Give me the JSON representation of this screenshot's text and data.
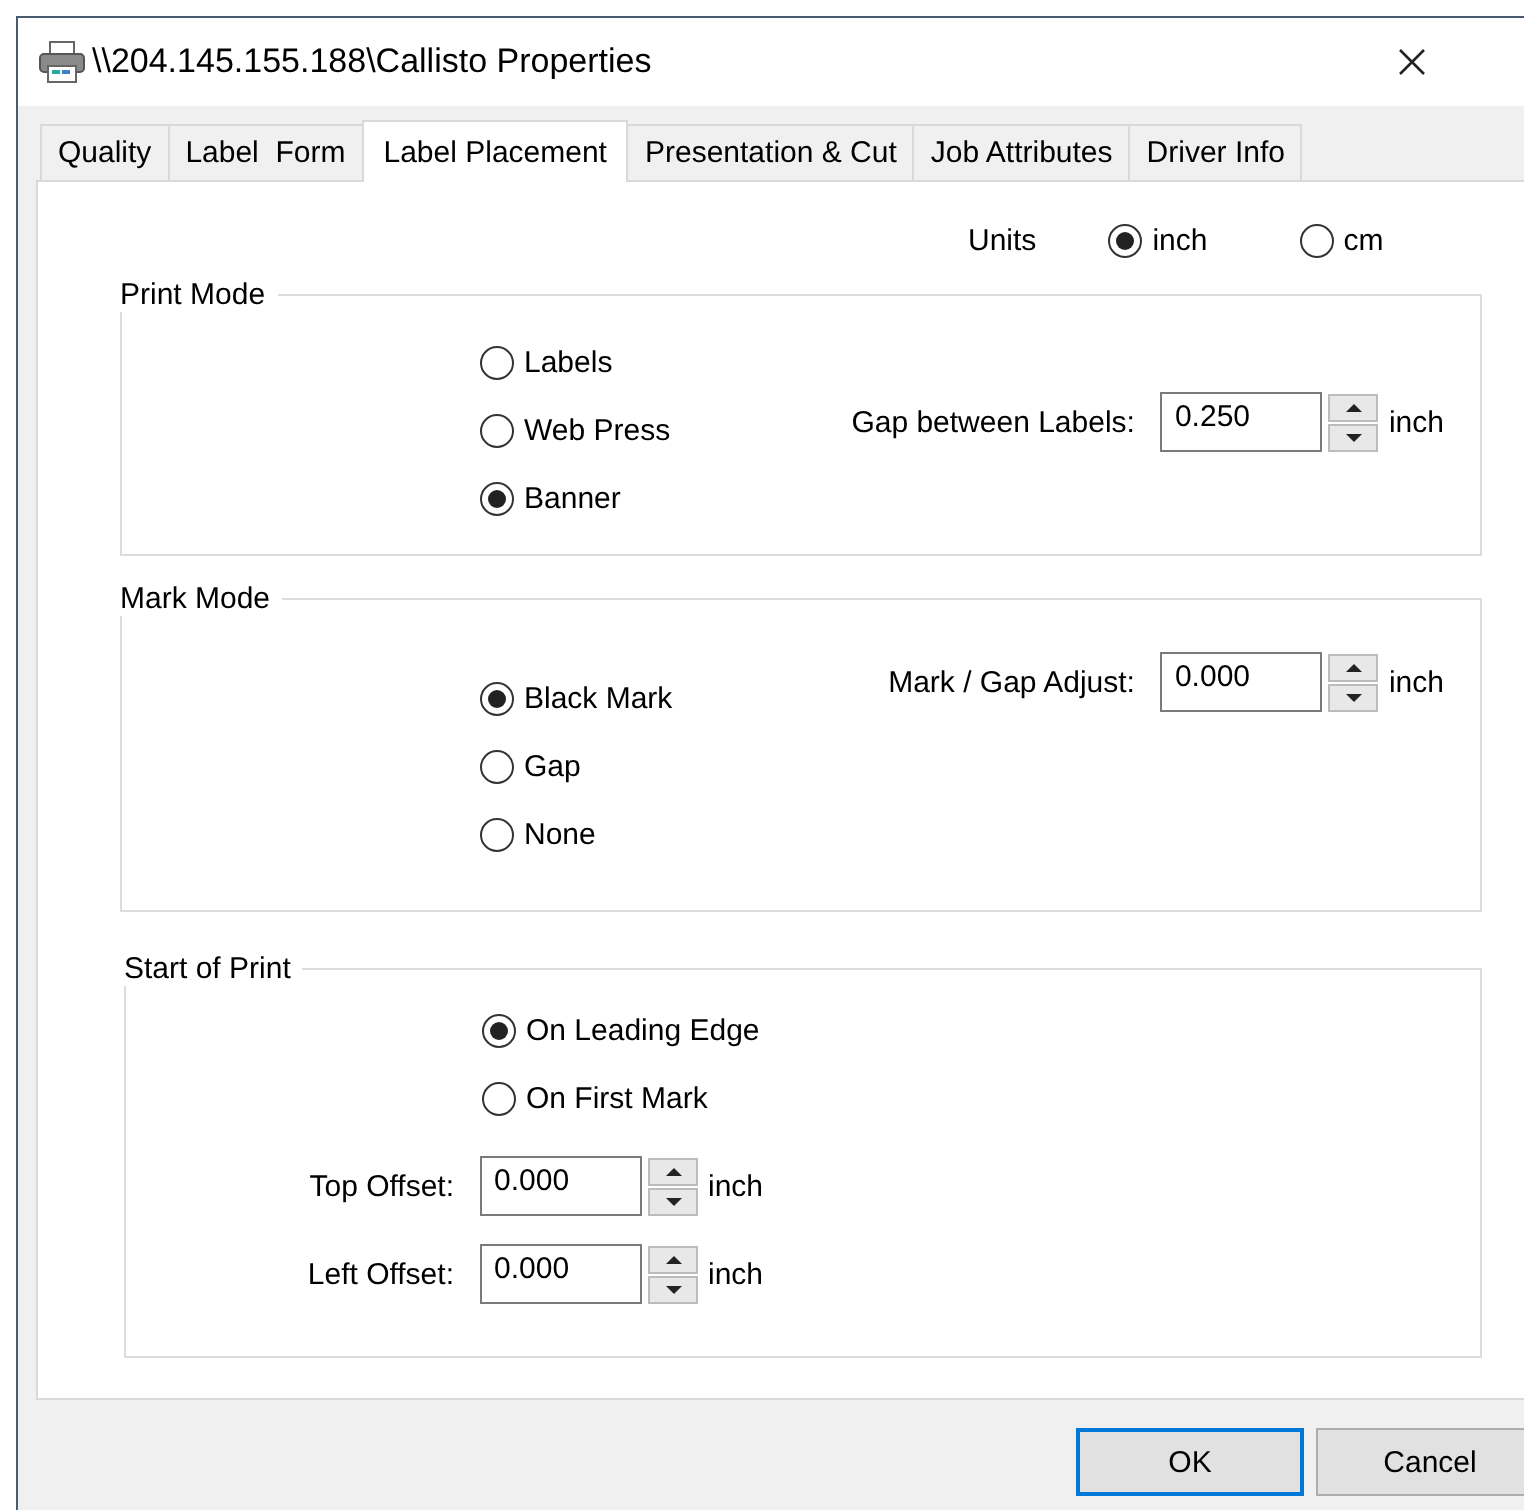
{
  "window": {
    "title": "\\\\204.145.155.188\\Callisto Properties"
  },
  "tabs": [
    {
      "label": "Quality",
      "selected": false
    },
    {
      "label": "Label  Form",
      "selected": false
    },
    {
      "label": "Label Placement",
      "selected": true
    },
    {
      "label": "Presentation & Cut",
      "selected": false
    },
    {
      "label": "Job Attributes",
      "selected": false
    },
    {
      "label": "Driver Info",
      "selected": false
    }
  ],
  "units": {
    "label": "Units",
    "options": [
      {
        "label": "inch",
        "selected": true
      },
      {
        "label": "cm",
        "selected": false
      }
    ]
  },
  "groups": [
    {
      "title": "Print Mode",
      "kind": "side",
      "options": [
        {
          "label": "Labels",
          "selected": false
        },
        {
          "label": "Web Press",
          "selected": false
        },
        {
          "label": "Banner",
          "selected": true
        }
      ],
      "fields": [
        {
          "label": "Gap between Labels:",
          "value": "0.250",
          "unit": "inch"
        }
      ]
    },
    {
      "title": "Mark Mode",
      "kind": "side",
      "options": [
        {
          "label": "Black Mark",
          "selected": true
        },
        {
          "label": "Gap",
          "selected": false
        },
        {
          "label": "None",
          "selected": false
        }
      ],
      "fields": [
        {
          "label": "Mark / Gap Adjust:",
          "value": "0.000",
          "unit": "inch"
        }
      ]
    },
    {
      "title": "Start of Print",
      "kind": "below",
      "options": [
        {
          "label": "On Leading Edge",
          "selected": true
        },
        {
          "label": "On First Mark",
          "selected": false
        }
      ],
      "fields": [
        {
          "label": "Top Offset:",
          "value": "0.000",
          "unit": "inch"
        },
        {
          "label": "Left Offset:",
          "value": "0.000",
          "unit": "inch"
        }
      ]
    }
  ],
  "buttons": [
    {
      "label": "OK",
      "default": true
    },
    {
      "label": "Cancel",
      "default": false
    }
  ]
}
